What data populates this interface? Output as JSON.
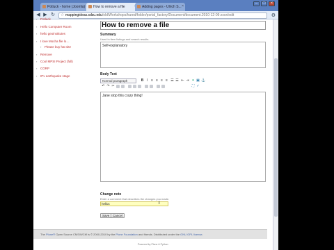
{
  "browser": {
    "tabs": [
      {
        "label": "Potluck - home (Joomla)"
      },
      {
        "label": "How to remove a file"
      },
      {
        "label": "Adding pages - Ulrich S..."
      }
    ],
    "url_host": "mappingideas.sdsu.edu",
    "url_path": "/old/Workshops/hared/folder/portal_factory/Document/document.2010-12-09.xxxx/edit"
  },
  "sidebar": {
    "items": [
      {
        "label": "Potluck"
      },
      {
        "label": "Hello Computer Room"
      },
      {
        "label": "hello geoinstitutes"
      },
      {
        "label": "I love Mocha file lo…"
      },
      {
        "label": "Please buy hat site"
      },
      {
        "label": "Remove"
      },
      {
        "label": "Cool MPSI Project (full)"
      },
      {
        "label": "CORP"
      },
      {
        "label": "IPv earthquake stage"
      }
    ]
  },
  "form": {
    "title_value": "How to remove a file",
    "summary_label": "Summary",
    "summary_hint": "Used in item listings and search results.",
    "summary_value": "Self-explanatory",
    "body_label": "Body Text",
    "format_select": "Normal paragraph",
    "body_value": "Jane stop this crazy thing!",
    "change_note_label": "Change note",
    "change_note_hint": "Enter a comment that describes the changes you made.",
    "change_note_value": "helloc",
    "save_label": "Save",
    "cancel_label": "Cancel"
  },
  "footer": {
    "text_before": "The ",
    "plone_link": "Plone®",
    "text_mid1": " Open Source CMS/WCM",
    "text_mid2": " is © 2000-2010 by the ",
    "foundation_link": "Plone Foundation",
    "text_mid3": " and friends. Distributed under the ",
    "license_link": "GNU GPL license",
    "text_end": ".",
    "powered": "Powered by Plone & Python"
  },
  "colors": {
    "tab_bar": "#5a7fc0",
    "sidebar_link": "#c03030",
    "change_note_bg": "#ffffc0"
  }
}
